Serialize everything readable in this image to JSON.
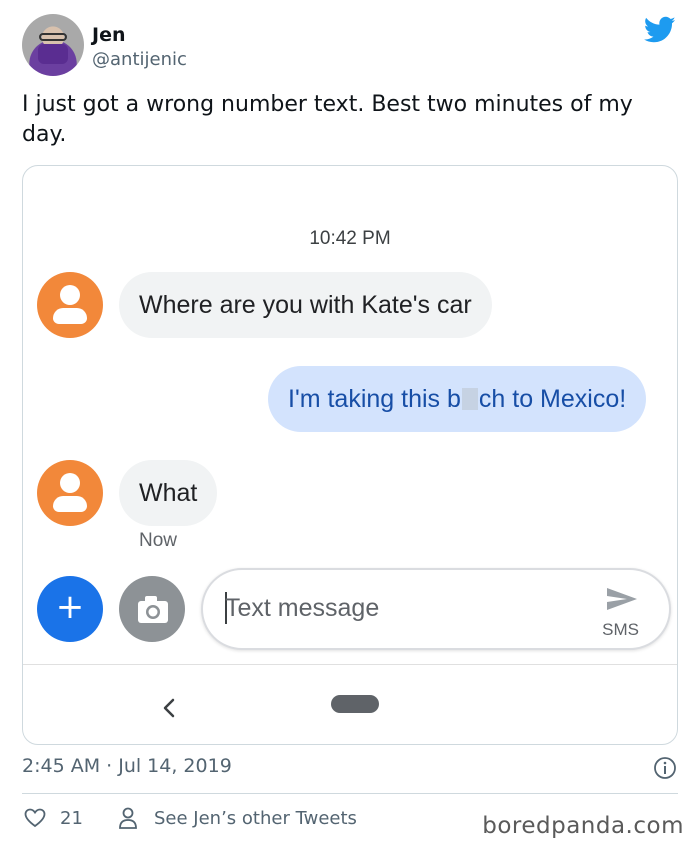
{
  "tweet": {
    "user_name": "Jen",
    "user_handle": "@antijenic",
    "text": "I just got a wrong number text. Best two minutes of my day.",
    "date": "2:45 AM · Jul 14, 2019",
    "like_count": "21",
    "other_tweets_label": "See Jen’s other Tweets",
    "brand_color": "#1d9bf0"
  },
  "screenshot": {
    "time_stamp": "10:42 PM",
    "messages": [
      {
        "direction": "incoming",
        "text": "Where are you with Kate's car"
      },
      {
        "direction": "outgoing",
        "text_before": "I'm taking this b",
        "text_after": "ch to Mexico!"
      },
      {
        "direction": "incoming",
        "text": "What"
      }
    ],
    "last_message_status": "Now",
    "compose": {
      "placeholder": "Text message",
      "send_label": "SMS"
    },
    "colors": {
      "contact_avatar": "#f2883a",
      "add_button": "#1a73e8",
      "outgoing_bubble": "#d3e3fd",
      "incoming_bubble": "#f1f3f4"
    }
  },
  "watermark": "boredpanda.com"
}
